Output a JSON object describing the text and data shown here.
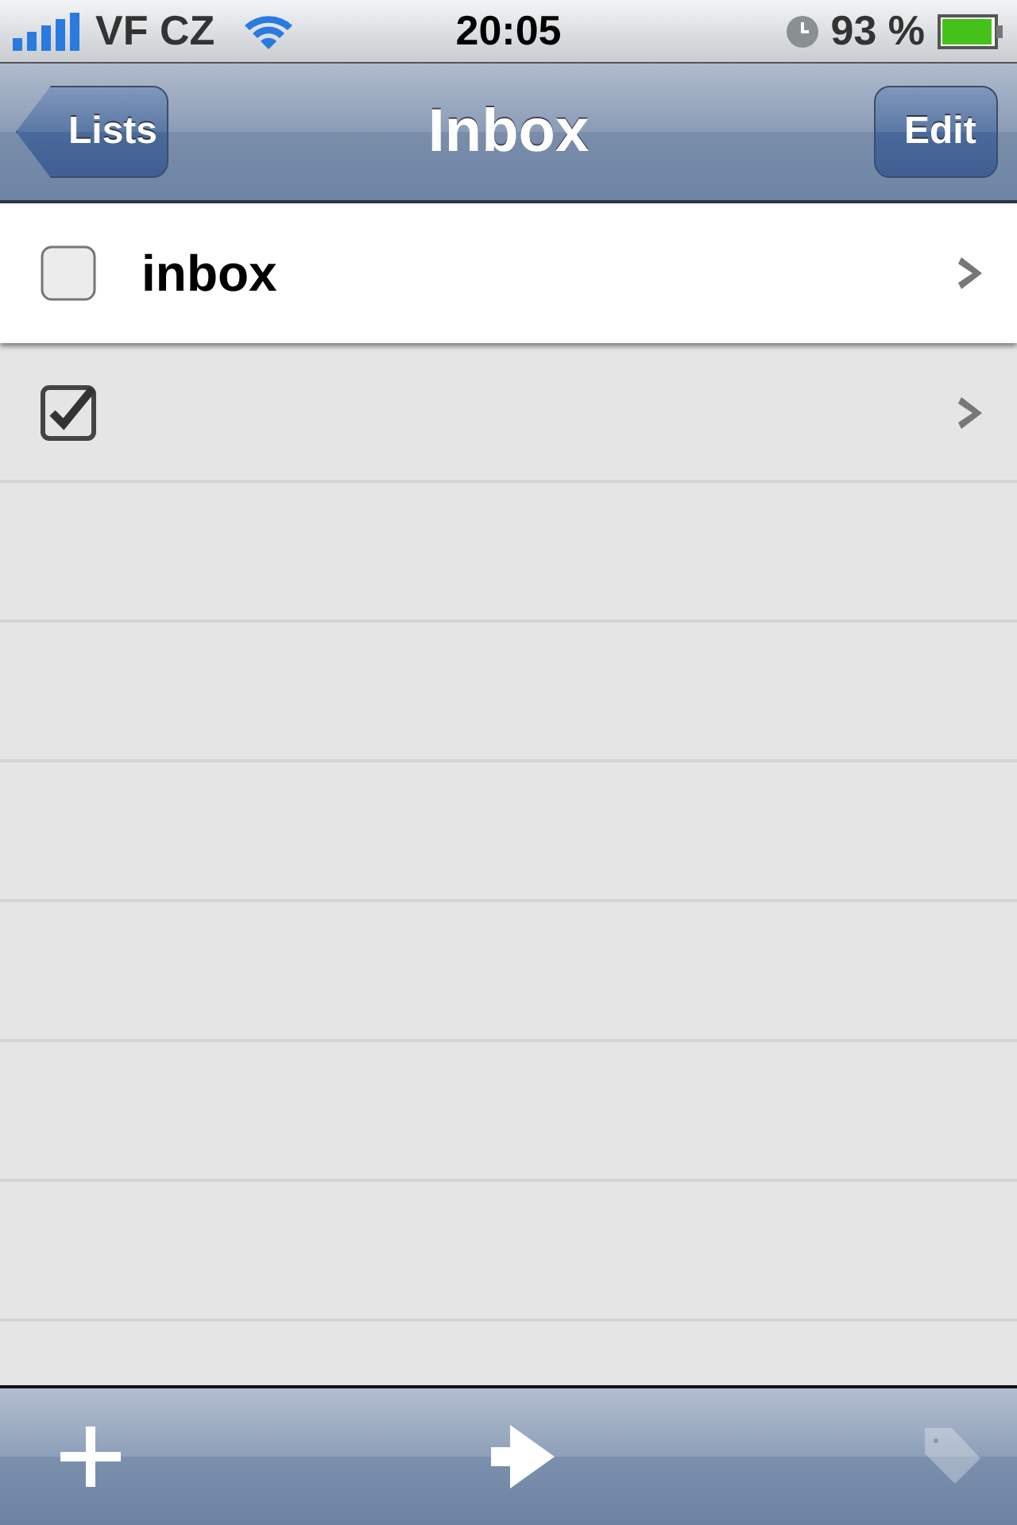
{
  "status_bar": {
    "carrier": "VF CZ",
    "time": "20:05",
    "battery": "93 %"
  },
  "nav": {
    "back": "Lists",
    "title": "Inbox",
    "action": "Edit"
  },
  "rows": [
    {
      "title": "inbox",
      "checked": false,
      "selected": true
    },
    {
      "checked": true,
      "selected": false
    }
  ],
  "toolbar": [
    {
      "kind": "add",
      "disabled": false
    },
    {
      "kind": "move",
      "disabled": false
    },
    {
      "kind": "tag",
      "disabled": true
    }
  ]
}
